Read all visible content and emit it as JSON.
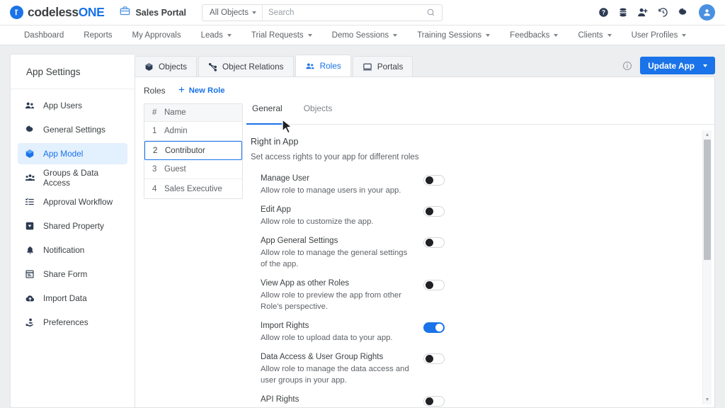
{
  "brand": {
    "name_primary": "codeless",
    "name_accent": "ONE",
    "logo_icon": "codeless-one-logo"
  },
  "header": {
    "portal_icon": "briefcase-icon",
    "portal_name": "Sales Portal",
    "search": {
      "scope_label": "All Objects",
      "placeholder": "Search",
      "value": "",
      "icon": "search-icon"
    },
    "icons": [
      {
        "name": "help-icon",
        "glyph": "?"
      },
      {
        "name": "database-icon",
        "glyph": ""
      },
      {
        "name": "add-user-icon",
        "glyph": ""
      },
      {
        "name": "history-icon",
        "glyph": ""
      },
      {
        "name": "settings-gear-icon",
        "glyph": ""
      },
      {
        "name": "user-avatar",
        "glyph": ""
      }
    ]
  },
  "nav": [
    {
      "label": "Dashboard",
      "has_dropdown": false
    },
    {
      "label": "Reports",
      "has_dropdown": false
    },
    {
      "label": "My Approvals",
      "has_dropdown": false
    },
    {
      "label": "Leads",
      "has_dropdown": true
    },
    {
      "label": "Trial Requests",
      "has_dropdown": true
    },
    {
      "label": "Demo Sessions",
      "has_dropdown": true
    },
    {
      "label": "Training Sessions",
      "has_dropdown": true
    },
    {
      "label": "Feedbacks",
      "has_dropdown": true
    },
    {
      "label": "Clients",
      "has_dropdown": true
    },
    {
      "label": "User Profiles",
      "has_dropdown": true
    }
  ],
  "sidebar": {
    "title": "App Settings",
    "items": [
      {
        "label": "App Users",
        "icon": "users-icon",
        "active": false
      },
      {
        "label": "General Settings",
        "icon": "gear-icon",
        "active": false
      },
      {
        "label": "App Model",
        "icon": "cube-icon",
        "active": true
      },
      {
        "label": "Groups & Data Access",
        "icon": "user-group-icon",
        "active": false
      },
      {
        "label": "Approval Workflow",
        "icon": "checklist-icon",
        "active": false
      },
      {
        "label": "Shared Property",
        "icon": "shared-property-icon",
        "active": false
      },
      {
        "label": "Notification",
        "icon": "bell-icon",
        "active": false
      },
      {
        "label": "Share Form",
        "icon": "form-icon",
        "active": false
      },
      {
        "label": "Import Data",
        "icon": "cloud-upload-icon",
        "active": false
      },
      {
        "label": "Preferences",
        "icon": "preferences-icon",
        "active": false
      }
    ]
  },
  "tabs": [
    {
      "label": "Objects",
      "icon": "cube-icon",
      "active": false
    },
    {
      "label": "Object Relations",
      "icon": "relations-icon",
      "active": false
    },
    {
      "label": "Roles",
      "icon": "users-icon",
      "active": true
    },
    {
      "label": "Portals",
      "icon": "portal-icon",
      "active": false
    }
  ],
  "toolbar": {
    "info_icon": "info-icon",
    "update_label": "Update App",
    "update_caret": "caret-down-icon",
    "accent_color": "#1a73e8"
  },
  "roles_panel": {
    "heading": "Roles",
    "new_role_label": "New Role",
    "new_role_icon": "plus-icon",
    "columns": [
      "#",
      "Name"
    ],
    "rows": [
      {
        "num": "1",
        "name": "Admin",
        "selected": false
      },
      {
        "num": "2",
        "name": "Contributor",
        "selected": true
      },
      {
        "num": "3",
        "name": "Guest",
        "selected": false
      },
      {
        "num": "4",
        "name": "Sales Executive",
        "selected": false
      }
    ]
  },
  "detail": {
    "tabs": [
      {
        "label": "General",
        "active": true
      },
      {
        "label": "Objects",
        "active": false
      }
    ],
    "section_title": "Right in App",
    "section_subtitle": "Set access rights to your app for different roles",
    "options": [
      {
        "name": "Manage User",
        "desc": "Allow role to manage users in your app.",
        "on": false
      },
      {
        "name": "Edit App",
        "desc": "Allow role to customize the app.",
        "on": false
      },
      {
        "name": "App General Settings",
        "desc": "Allow role to manage the general settings of the app.",
        "on": false
      },
      {
        "name": "View App as other Roles",
        "desc": "Allow role to preview the app from other Role's perspective.",
        "on": false
      },
      {
        "name": "Import Rights",
        "desc": "Allow role to upload data to your app.",
        "on": true
      },
      {
        "name": "Data Access & User Group Rights",
        "desc": "Allow role to manage the data access and user groups in your app.",
        "on": false
      },
      {
        "name": "API Rights",
        "desc": "",
        "on": false
      }
    ],
    "scrollbar": {
      "up_icon": "scroll-up-icon",
      "down_icon": "scroll-down-icon"
    }
  }
}
